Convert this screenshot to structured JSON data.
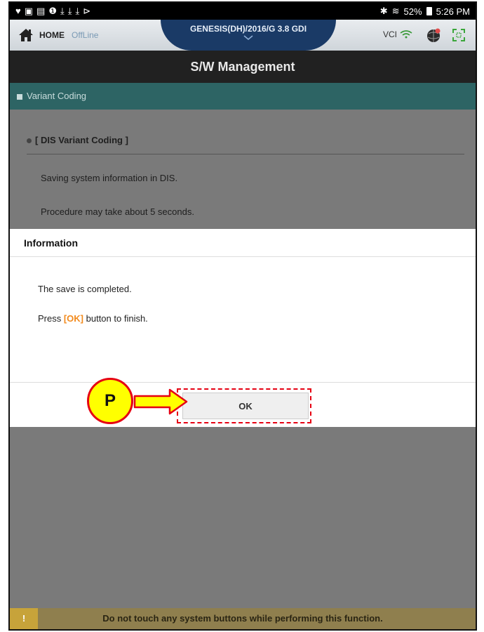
{
  "status_bar": {
    "left_icons": [
      "navigation-icon",
      "gallery-icon",
      "calendar-icon",
      "alert-icon",
      "download-icon",
      "download-icon",
      "download-icon",
      "flag-icon"
    ],
    "left_glyphs": [
      "♥",
      "▣",
      "▤",
      "❶",
      "⤓",
      "⤓",
      "⤓",
      "⊳"
    ],
    "bluetooth": "✱",
    "wifi": "≋",
    "battery": "52%",
    "time": "5:26 PM"
  },
  "app_header": {
    "home_label": "HOME",
    "offline_label": "OffLine",
    "vehicle": "GENESIS(DH)/2016/G 3.8 GDI",
    "vci_label": "VCI"
  },
  "title": "S/W Management",
  "section": "Variant Coding",
  "content": {
    "heading": "[ DIS Variant Coding ]",
    "line1": "Saving system information in DIS.",
    "line2": "Procedure may take about 5 seconds."
  },
  "dialog": {
    "title": "Information",
    "message1": "The save is completed.",
    "message2_prefix": "Press ",
    "message2_highlight": "[OK]",
    "message2_suffix": " button to finish.",
    "ok_label": "OK"
  },
  "callout": {
    "label": "P"
  },
  "warning": {
    "icon": "!",
    "text": "Do not touch any system buttons while performing this function."
  },
  "colors": {
    "section_bar": "#2d6464",
    "vehicle_tab": "#1a3a66",
    "ok_highlight": "#f28a1c",
    "callout_fill": "#ffff00",
    "callout_border": "#e60012",
    "warning_bar": "#8f7f4e"
  }
}
